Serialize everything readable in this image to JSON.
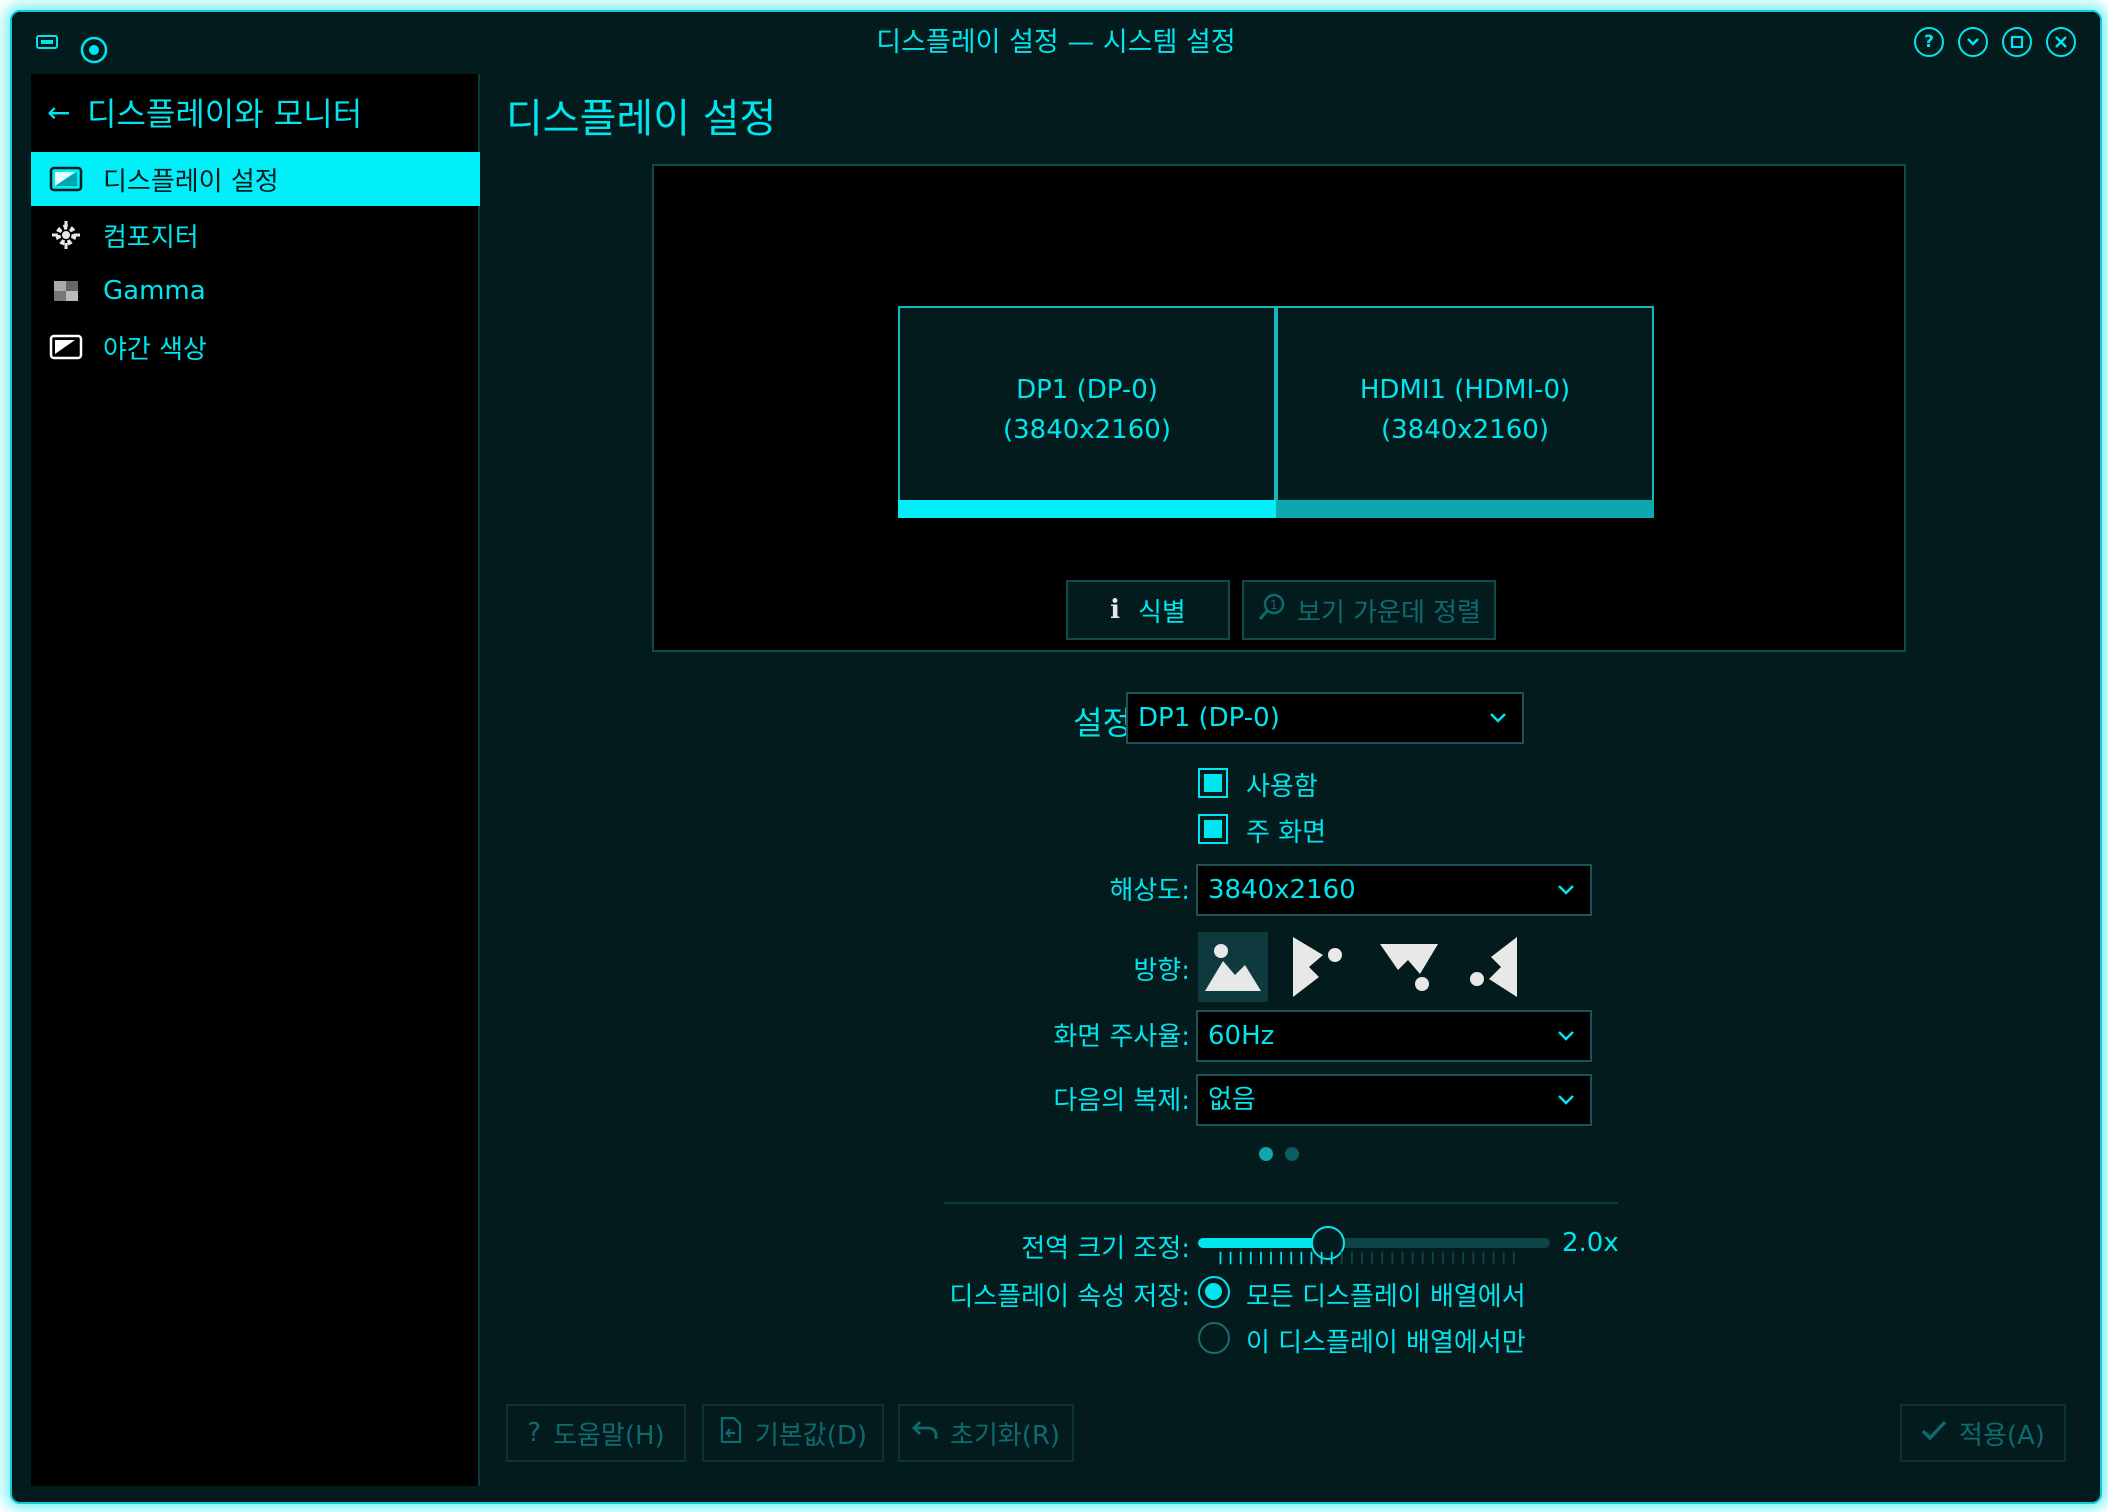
{
  "window": {
    "title": "디스플레이 설정 — 시스템 설정",
    "controls": [
      "help-icon",
      "minimize-icon",
      "maximize-icon",
      "close-icon"
    ]
  },
  "sidebar": {
    "header": "디스플레이와 모니터",
    "back_icon": "arrow-left-icon",
    "items": [
      {
        "label": "디스플레이 설정",
        "icon": "display-icon",
        "active": true
      },
      {
        "label": "컴포지터",
        "icon": "compositor-gear-icon",
        "active": false
      },
      {
        "label": "Gamma",
        "icon": "gamma-icon",
        "active": false
      },
      {
        "label": "야간 색상",
        "icon": "night-color-icon",
        "active": false
      }
    ]
  },
  "main": {
    "title": "디스플레이 설정",
    "monitors": [
      {
        "name": "DP1 (DP-0)",
        "resolution": "(3840x2160)",
        "primary": true
      },
      {
        "name": "HDMI1 (HDMI-0)",
        "resolution": "(3840x2160)",
        "primary": false
      }
    ],
    "identify_label": "식별",
    "center_view_label": "보기 가운데 정렬",
    "settings": {
      "label": "설정",
      "output_value": "DP1 (DP-0)",
      "enabled_label": "사용함",
      "enabled": true,
      "primary_label": "주 화면",
      "primary": true,
      "resolution_label": "해상도:",
      "resolution_value": "3840x2160",
      "orientation_label": "방향:",
      "orientations": [
        "orientation-normal-icon",
        "orientation-90-icon",
        "orientation-180-icon",
        "orientation-270-icon"
      ],
      "refresh_label": "화면 주사율:",
      "refresh_value": "60Hz",
      "mirror_label": "다음의 복제:",
      "mirror_value": "없음"
    },
    "global_scale": {
      "label": "전역 크기 조정:",
      "value_text": "2.0x",
      "fraction": 0.37
    },
    "save_props": {
      "label": "디스플레이 속성 저장:",
      "options": [
        {
          "label": "모든 디스플레이 배열에서",
          "selected": true
        },
        {
          "label": "이 디스플레이 배열에서만",
          "selected": false
        }
      ]
    },
    "buttons": {
      "help": "도움말(H)",
      "defaults": "기본값(D)",
      "reset": "초기화(R)",
      "apply": "적용(A)"
    }
  },
  "colors": {
    "accent": "#00e5ee",
    "background": "#041b1d",
    "sidebar_background": "#000000",
    "disabled": "#0d6b70",
    "secondary_bar": "#0ea7ae"
  }
}
